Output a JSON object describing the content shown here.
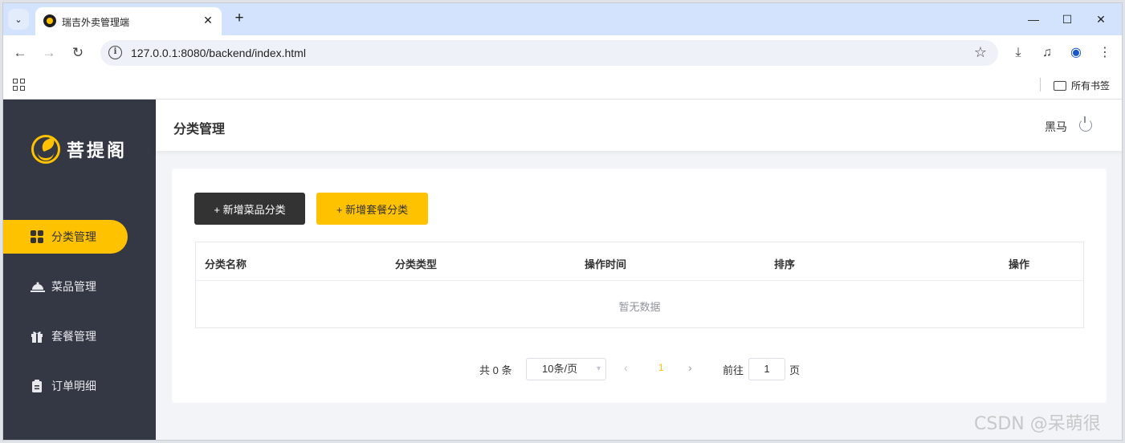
{
  "browser": {
    "tab_title": "瑞吉外卖管理端",
    "url": "127.0.0.1:8080/backend/index.html",
    "bookmarks_all": "所有书签"
  },
  "sidebar": {
    "logo_text": "菩提阁",
    "items": [
      {
        "label": "分类管理",
        "icon": "grid-icon",
        "active": true
      },
      {
        "label": "菜品管理",
        "icon": "cloche-icon",
        "active": false
      },
      {
        "label": "套餐管理",
        "icon": "gift-icon",
        "active": false
      },
      {
        "label": "订单明细",
        "icon": "clipboard-icon",
        "active": false
      }
    ]
  },
  "header": {
    "title": "分类管理",
    "user": "黑马"
  },
  "toolbar": {
    "add_dish_category": "+ 新增菜品分类",
    "add_combo_category": "+ 新增套餐分类"
  },
  "table": {
    "columns": [
      "分类名称",
      "分类类型",
      "操作时间",
      "排序",
      "操作"
    ],
    "rows": [],
    "empty_text": "暂无数据"
  },
  "pagination": {
    "total_text": "共 0 条",
    "page_size": "10条/页",
    "current_page": "1",
    "goto_label": "前往",
    "goto_value": "1",
    "page_suffix": "页"
  },
  "watermark": "CSDN @呆萌很",
  "colors": {
    "accent": "#ffc200",
    "sidebar_bg": "#343744",
    "dark_button": "#333333"
  }
}
